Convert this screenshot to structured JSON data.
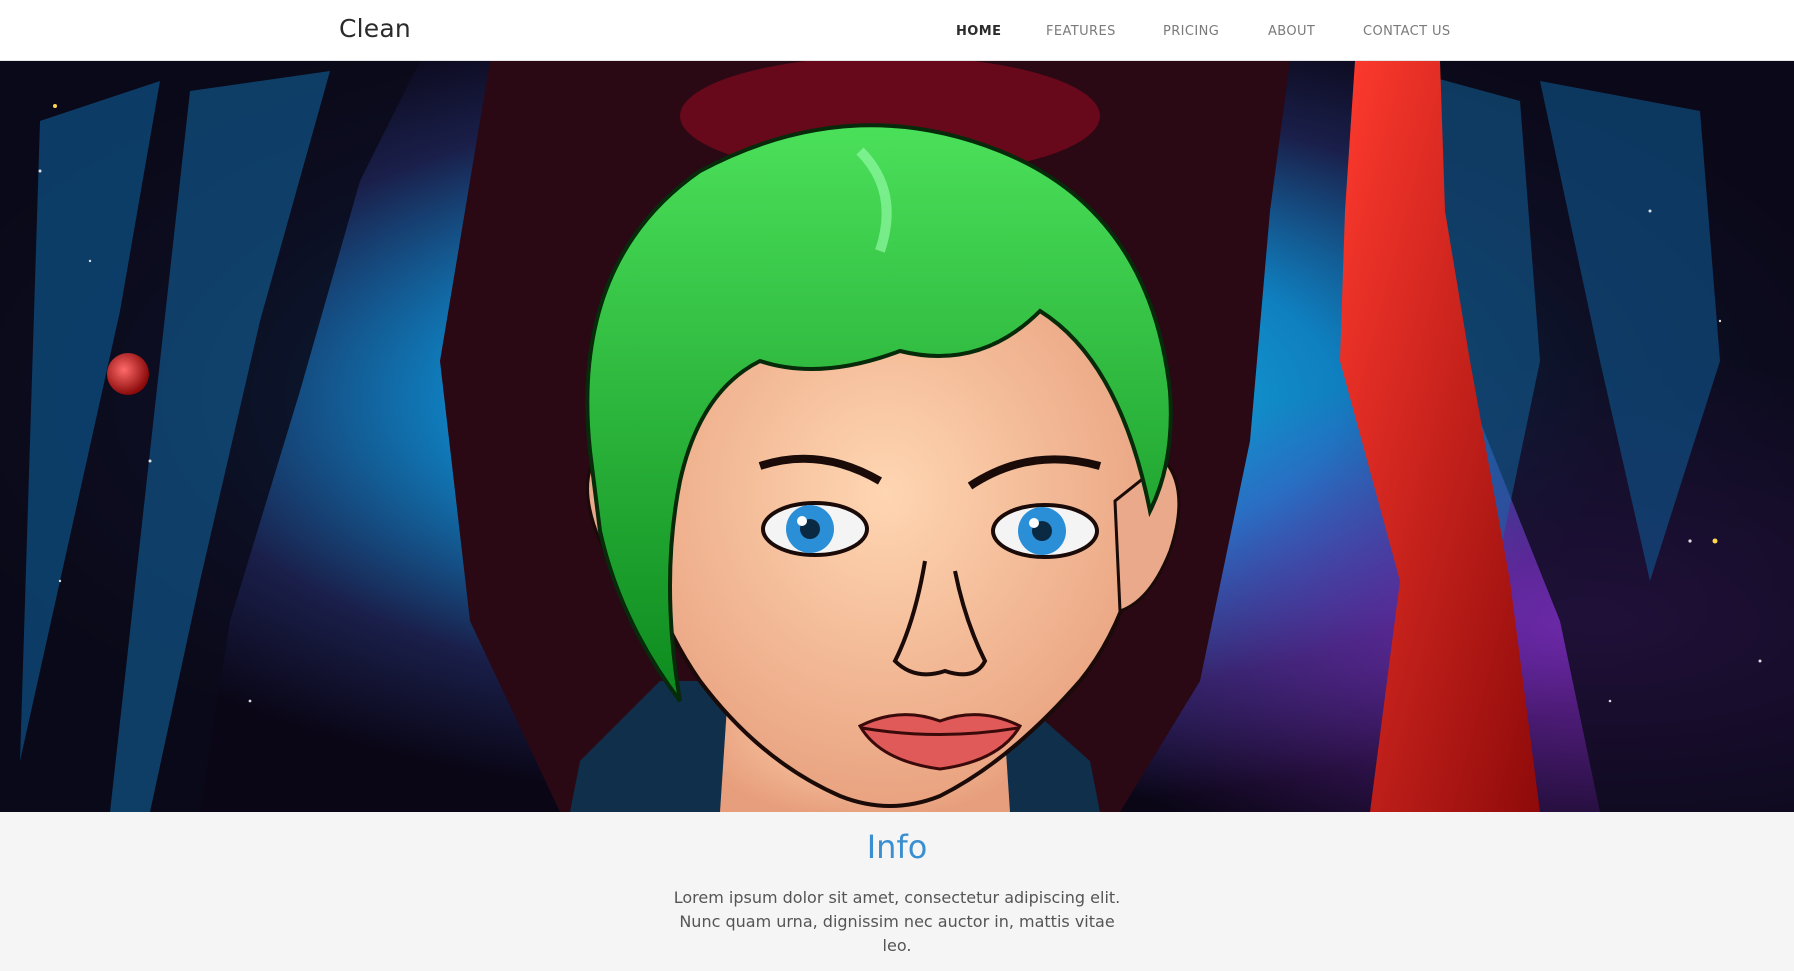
{
  "header": {
    "brand": "Clean",
    "nav": [
      {
        "label": "HOME",
        "active": true
      },
      {
        "label": "FEATURES",
        "active": false
      },
      {
        "label": "PRICING",
        "active": false
      },
      {
        "label": "ABOUT",
        "active": false
      },
      {
        "label": "CONTACT US",
        "active": false
      }
    ]
  },
  "hero": {
    "image": "comic-portrait-green-hair-space-background"
  },
  "info": {
    "title": "Info",
    "text": "Lorem ipsum dolor sit amet, consectetur adipiscing elit. Nunc quam urna, dignissim nec auctor in, mattis vitae leo."
  },
  "colors": {
    "accent": "#3a8fd0",
    "nav_active": "#2b2b2b",
    "nav_inactive": "#7a7a7a",
    "info_bg": "#f5f5f5"
  }
}
